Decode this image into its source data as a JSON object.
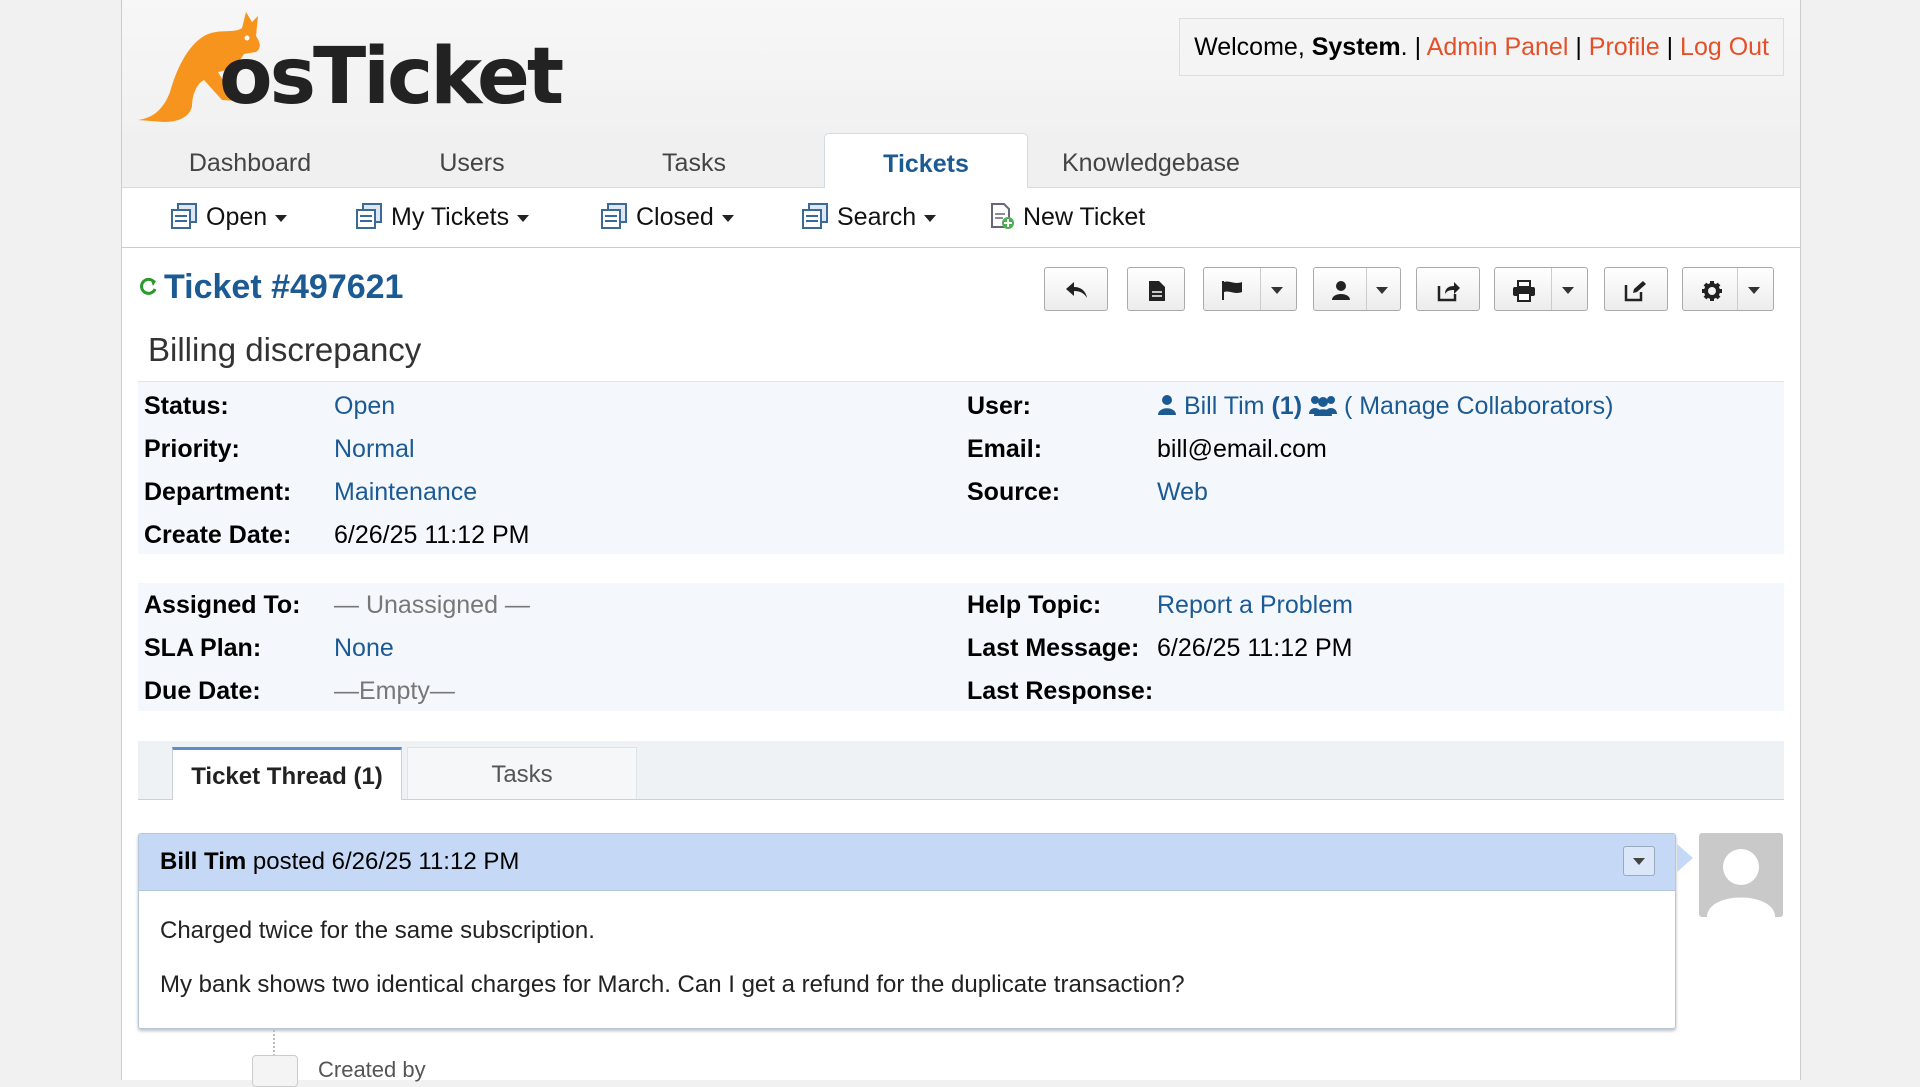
{
  "header": {
    "logo_text": "osTicket",
    "welcome_prefix": "Welcome, ",
    "welcome_user": "System",
    "welcome_suffix": ".",
    "links": [
      "Admin Panel",
      "Profile",
      "Log Out"
    ]
  },
  "nav": {
    "tabs": [
      "Dashboard",
      "Users",
      "Tasks",
      "Tickets",
      "Knowledgebase"
    ],
    "active": "Tickets"
  },
  "subnav": {
    "items": [
      "Open",
      "My Tickets",
      "Closed",
      "Search",
      "New Ticket"
    ]
  },
  "ticket": {
    "title": "Ticket #497621",
    "subject": "Billing discrepancy",
    "labels": {
      "status": "Status:",
      "priority": "Priority:",
      "department": "Department:",
      "create_date": "Create Date:",
      "user": "User:",
      "email": "Email:",
      "source": "Source:",
      "assigned_to": "Assigned To:",
      "sla_plan": "SLA Plan:",
      "due_date": "Due Date:",
      "help_topic": "Help Topic:",
      "last_message": "Last Message:",
      "last_response": "Last Response:"
    },
    "status": "Open",
    "priority": "Normal",
    "department": "Maintenance",
    "create_date": "6/26/25 11:12 PM",
    "user_name": "Bill Tim",
    "user_count": "(1)",
    "manage_collaborators": "( Manage Collaborators)",
    "email": "bill@email.com",
    "source": "Web",
    "assigned_to": "— Unassigned —",
    "sla_plan": "None",
    "due_date": "—Empty—",
    "help_topic": "Report a Problem",
    "last_message": "6/26/25 11:12 PM",
    "last_response": ""
  },
  "thread": {
    "tabs": [
      "Ticket Thread (1)",
      "Tasks"
    ],
    "entry": {
      "author": "Bill Tim",
      "posted": "posted 6/26/25 11:12 PM",
      "lines": [
        "Charged twice for the same subscription.",
        "My bank shows two identical charges for March. Can I get a refund for the duplicate transaction?"
      ]
    },
    "event_text": "Created by"
  },
  "colors": {
    "link_blue": "#1c5a94",
    "accent_orange": "#e4502a",
    "entry_header": "#c5d9f6"
  }
}
